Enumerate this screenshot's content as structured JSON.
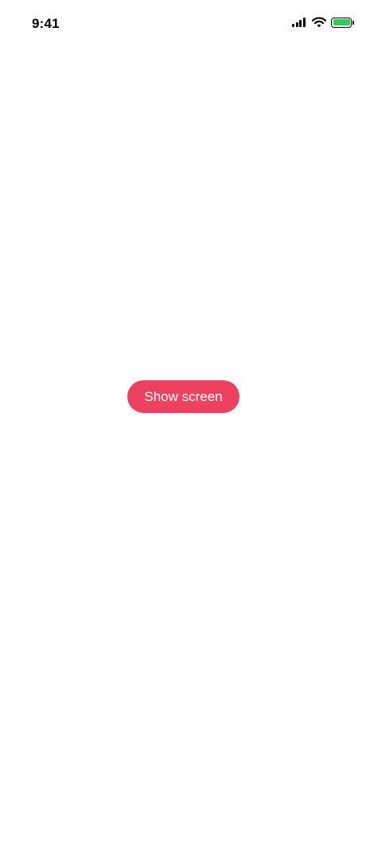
{
  "status_bar": {
    "time": "9:41",
    "icons": [
      "signal-icon",
      "wifi-icon",
      "battery-icon"
    ],
    "battery_color": "#34c759"
  },
  "main": {
    "button_label": "Show screen",
    "button_color": "#ee4160"
  }
}
